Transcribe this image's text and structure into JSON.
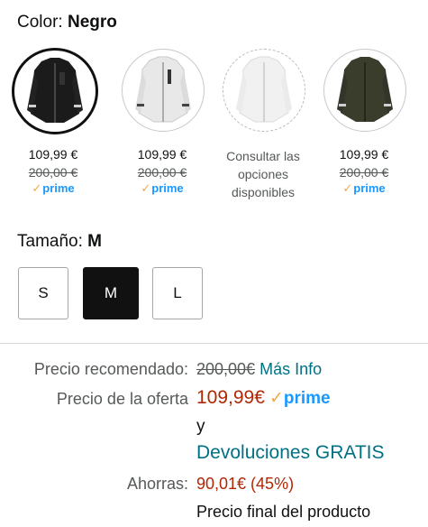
{
  "color": {
    "label": "Color:",
    "selected": "Negro"
  },
  "swatches": [
    {
      "name": "Negro",
      "price": "109,99 €",
      "list_price": "200,00 €",
      "prime": "prime"
    },
    {
      "name": "Blanco",
      "price": "109,99 €",
      "list_price": "200,00 €",
      "prime": "prime"
    },
    {
      "name": "Blanco claro",
      "consult": "Consultar las opciones disponibles"
    },
    {
      "name": "Verde oliva",
      "price": "109,99 €",
      "list_price": "200,00 €",
      "prime": "prime"
    }
  ],
  "size": {
    "label": "Tamaño:",
    "selected": "M",
    "options": [
      "S",
      "M",
      "L"
    ]
  },
  "pricing": {
    "recommended_label": "Precio recomendado:",
    "recommended_value": "200,00€",
    "more_info": "Más Info",
    "offer_label": "Precio de la oferta",
    "offer_value": "109,99€",
    "prime": "prime",
    "and": "y",
    "free_returns": "Devoluciones GRATIS",
    "savings_label": "Ahorras:",
    "savings_value": "90,01€ (45%)",
    "final_note": "Precio final del producto"
  },
  "colors": {
    "accent_link": "#007185",
    "price_red": "#b12704",
    "prime_blue": "#1a98ff",
    "prime_check": "#f3a847"
  }
}
